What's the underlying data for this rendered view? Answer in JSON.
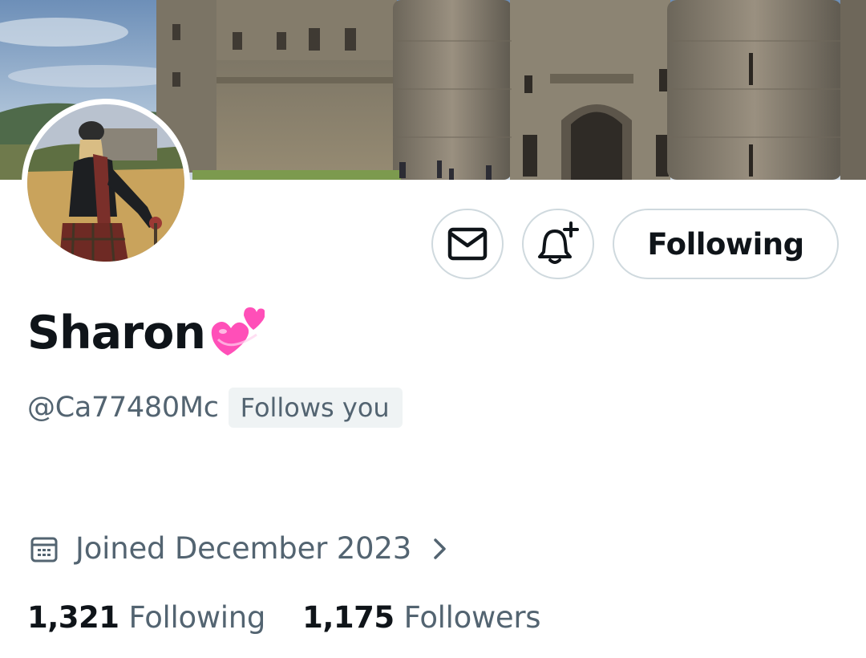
{
  "profile": {
    "display_name": "Sharon",
    "name_emoji": "revolving-hearts",
    "handle": "@Ca77480Mc",
    "follows_you_badge": "Follows you",
    "joined": "Joined December 2023",
    "following_count": "1,321",
    "following_label": "Following",
    "followers_count": "1,175",
    "followers_label": "Followers"
  },
  "actions": {
    "message_icon": "envelope-icon",
    "notify_icon": "bell-plus-icon",
    "follow_button_label": "Following"
  },
  "colors": {
    "text_primary": "#0f1419",
    "text_secondary": "#536471",
    "border": "#cfd9de",
    "badge_bg": "#eff3f4",
    "emoji_pink": "#ff4fb8"
  }
}
